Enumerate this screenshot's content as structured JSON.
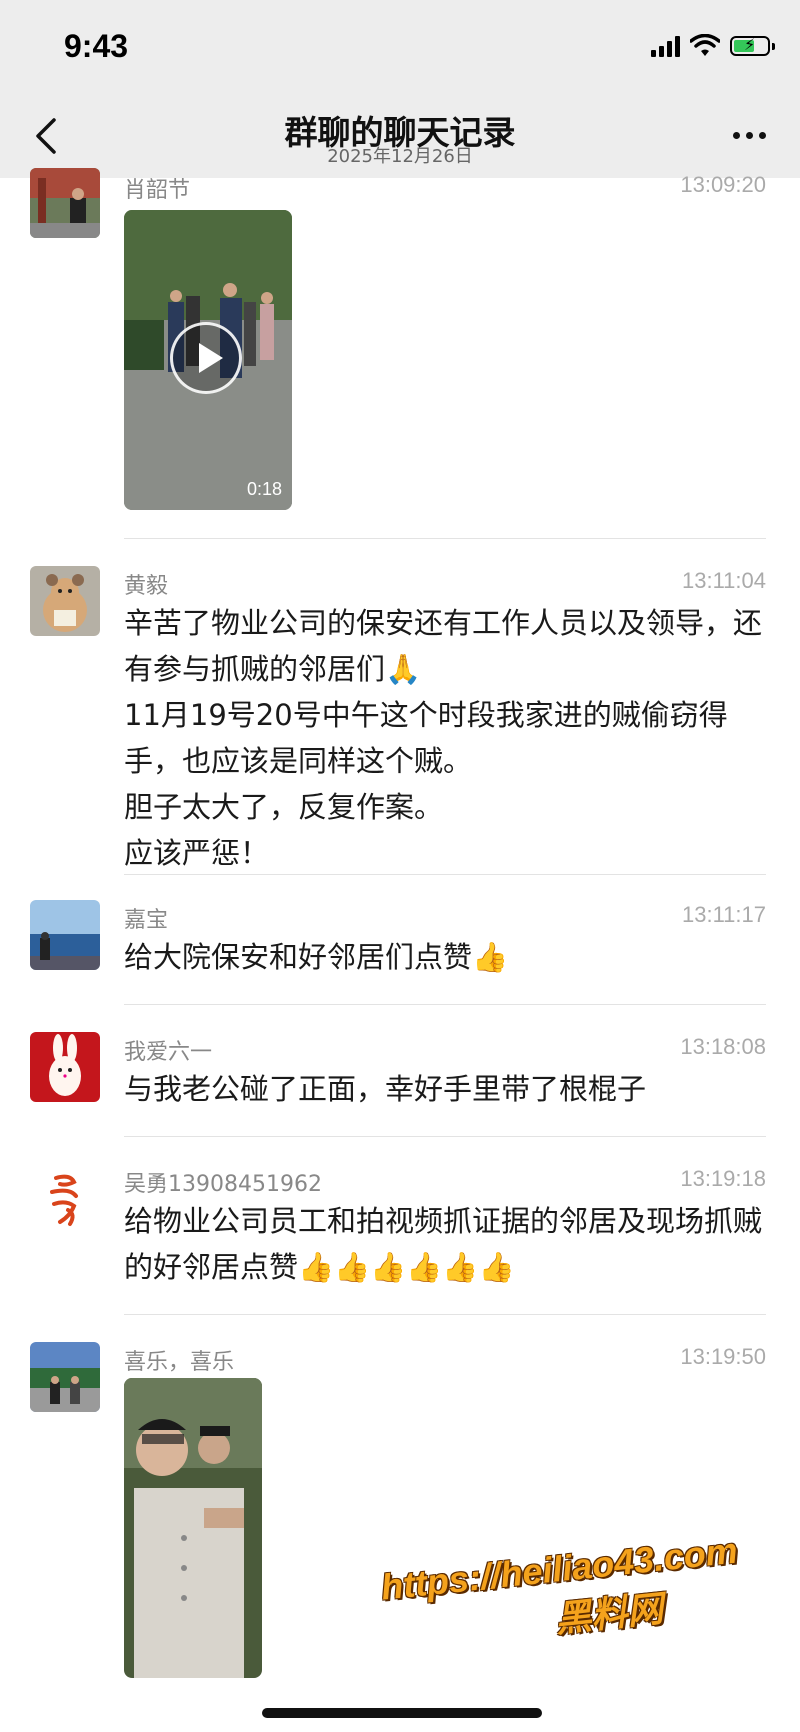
{
  "status": {
    "time": "9:43"
  },
  "nav": {
    "title": "群聊的聊天记录",
    "subtitle": "2025年12月26日"
  },
  "messages": [
    {
      "name": "肖韶节",
      "time": "13:09:20",
      "video_duration": "0:18"
    },
    {
      "name": "黄毅",
      "time": "13:11:04",
      "text": "辛苦了物业公司的保安还有工作人员以及领导，还有参与抓贼的邻居们🙏\n11月19号20号中午这个时段我家进的贼偷窃得手，也应该是同样这个贼。\n胆子太大了，反复作案。\n应该严惩！"
    },
    {
      "name": "嘉宝",
      "time": "13:11:17",
      "text": "给大院保安和好邻居们点赞👍"
    },
    {
      "name": "我爱六一",
      "time": "13:18:08",
      "text": "与我老公碰了正面，幸好手里带了根棍子"
    },
    {
      "name": "吴勇13908451962",
      "time": "13:19:18",
      "text": "给物业公司员工和拍视频抓证据的邻居及现场抓贼的好邻居点赞👍👍👍👍👍👍"
    },
    {
      "name": "喜乐，喜乐",
      "time": "13:19:50"
    }
  ],
  "watermark": {
    "url": "https://heiliao43.com",
    "name": "黑料网"
  },
  "colors": {
    "bar_bg": "#ededed",
    "battery": "#34c759",
    "watermark": "#f4a21c"
  }
}
